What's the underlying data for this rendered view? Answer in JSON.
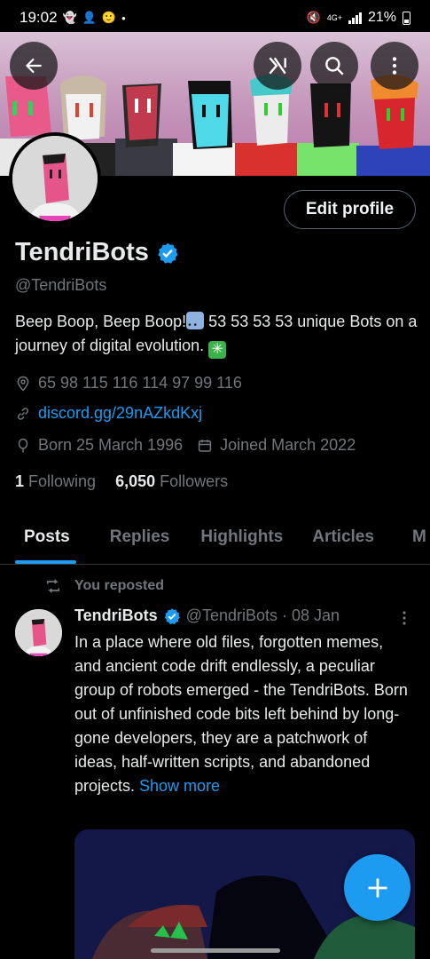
{
  "status_bar": {
    "time": "19:02",
    "network": "4G+",
    "battery": "21%"
  },
  "header": {
    "back_icon": "arrow-left-icon",
    "grok_icon": "grok-icon",
    "search_icon": "search-icon",
    "more_icon": "more-vertical-icon"
  },
  "profile": {
    "edit_label": "Edit profile",
    "name": "TendriBots",
    "handle": "@TendriBots",
    "bio_part1": "Beep Boop, Beep Boop!",
    "bio_part2": " 53 53 53 53  unique Bots on a journey of digital evolution. ",
    "location": "65 98 115 116 114 97 99 116",
    "website": "discord.gg/29nAZkdKxj",
    "born": "Born 25 March 1996",
    "joined": "Joined March 2022",
    "following_count": "1",
    "following_label": "Following",
    "followers_count": "6,050",
    "followers_label": "Followers"
  },
  "tabs": [
    "Posts",
    "Replies",
    "Highlights",
    "Articles",
    "M"
  ],
  "post": {
    "repost_label": "You reposted",
    "name": "TendriBots",
    "handle_date": "@TendriBots · 08 Jan",
    "text": "In a place where old files, forgotten memes, and ancient code drift endlessly, a peculiar group of robots emerged - the TendriBots. Born out of unfinished code bits left behind by long-gone developers, they are a patchwork of ideas, half-written scripts, and abandoned projects. ",
    "show_more": "Show more"
  },
  "colors": {
    "accent": "#1d9bf0",
    "background": "#000000",
    "muted_text": "#71767b"
  }
}
